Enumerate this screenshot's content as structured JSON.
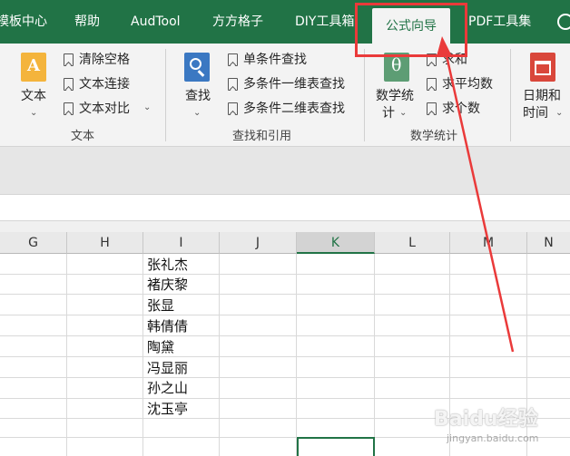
{
  "tabs": [
    {
      "label": "模板中心",
      "active": false
    },
    {
      "label": "帮助",
      "active": false
    },
    {
      "label": "AudTool",
      "active": false
    },
    {
      "label": "方方格子",
      "active": false
    },
    {
      "label": "DIY工具箱",
      "active": false
    },
    {
      "label": "公式向导",
      "active": true
    },
    {
      "label": "PDF工具集",
      "active": false
    }
  ],
  "groups": {
    "text": {
      "big_button": "文本",
      "items": [
        "清除空格",
        "文本连接",
        "文本对比"
      ],
      "label": "文本"
    },
    "lookup": {
      "big_button": "查找",
      "items": [
        "单条件查找",
        "多条件一维表查找",
        "多条件二维表查找"
      ],
      "label": "查找和引用"
    },
    "stats": {
      "big_button_line1": "数学统",
      "big_button_line2": "计",
      "items": [
        "求和",
        "求平均数",
        "求个数"
      ],
      "label": "数学统计"
    },
    "datetime": {
      "line1": "日期和",
      "line2": "时间"
    }
  },
  "columns": [
    "G",
    "H",
    "I",
    "J",
    "K",
    "L",
    "M",
    "N"
  ],
  "selected_column": "K",
  "cells_I": [
    "张礼杰",
    "褚庆黎",
    "张显",
    "韩倩倩",
    "陶黛",
    "冯显丽",
    "孙之山",
    "沈玉亭"
  ],
  "colors": {
    "ribbon_green": "#217346",
    "ribbon_body": "#f3f3f3",
    "annotation_red": "#ea3a3a"
  },
  "watermark": {
    "text": "Baidu经验",
    "url": "jingyan.baidu.com"
  }
}
